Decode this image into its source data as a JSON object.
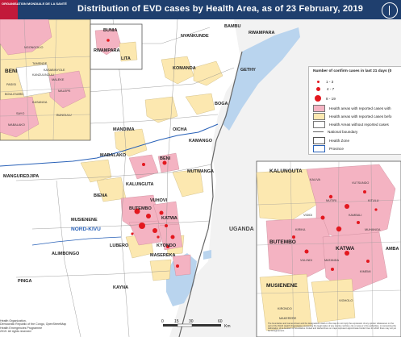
{
  "header": {
    "title": "Distribution of EVD cases by Health Area, as of 23 February, 2019",
    "logo_text": "ORGANISATION MONDIALE DE LA SANTÉ",
    "logo_word": "nté"
  },
  "colors": {
    "cases_21_days": "#f4b3c2",
    "cases_before": "#fce8b0",
    "no_cases": "#ffffff",
    "province_border": "#2a62b8",
    "case_dot": "#e3181f",
    "lake": "#b9d4ee"
  },
  "legend": {
    "title": "Number of confirm cases in last 21 days (0",
    "items": [
      {
        "label": "1 - 3",
        "type": "dot-small"
      },
      {
        "label": "4 - 7",
        "type": "dot-medium"
      },
      {
        "label": "8 - 19",
        "type": "dot-large"
      },
      {
        "label": "Health areas with reported cases with",
        "type": "fill-pink"
      },
      {
        "label": "Health areas with reported cases befo",
        "type": "fill-yellow"
      },
      {
        "label": "Health Areas without reported cases",
        "type": "fill-white"
      },
      {
        "label": "National boundary",
        "type": "line-gray"
      },
      {
        "label": "Health Zone",
        "type": "line-thin"
      },
      {
        "label": "Province",
        "type": "line-blue"
      }
    ]
  },
  "map_labels": {
    "zones": [
      "BUNIA",
      "RWAMPARA",
      "LITA",
      "NYANKUNDE",
      "BAMBU",
      "RWAMPARA",
      "GETHY",
      "KOMANDA",
      "BOGA",
      "MANDIMA",
      "OICHA",
      "KAMANGO",
      "MABALAKO",
      "BENI",
      "MUTWANGA",
      "MANGUREDJIPA",
      "KALUNGUTA",
      "BIENA",
      "VUHOVI",
      "MUSIENENE",
      "BUTEMBO",
      "KATWA",
      "LUBERO",
      "ALIMBONGO",
      "KYONDO",
      "MASEREKA",
      "PINGA",
      "KAYNA",
      "KALUNGUTA",
      "BUTEMBO",
      "KATWA",
      "MUSIENENE",
      "BENI",
      "AMBA"
    ],
    "province": "NORD-KIVU",
    "country": "UGANDA",
    "inset_left_small": [
      "NGONGOLIO",
      "TAMENDE",
      "KANZULINZULI",
      "MALEKE",
      "PASISI",
      "KASABINYOLE",
      "BOULEVARD",
      "KASANGA",
      "SAYO",
      "BUNGULU",
      "MABALAKO",
      "MALEPE"
    ],
    "inset_right_small": [
      "KALIVA",
      "VUTSUNDO",
      "MUTIRI",
      "KITULU",
      "VIDIDI",
      "KAMBALI",
      "KIRIKA",
      "MUHANGA",
      "VIGHOLO",
      "MATANDA",
      "KIMEMI",
      "VULINDI",
      "KIRONDO",
      "MAKERERE"
    ]
  },
  "scale": {
    "ticks": [
      "0",
      "15",
      "30",
      "60"
    ],
    "unit": "Km"
  },
  "footer": {
    "lines": [
      "Health Organization,",
      "Democratic Republic of the Congo, OpenStreetMap",
      "Health Emergencies Programme",
      "2019. All rights reserved"
    ]
  },
  "disclaimer": "The boundaries and names shown and the designations used on this map do not imply the expression of any opinion whatsoever on the part of the World Health Organization concerning the legal status of any country, territory, city or area or of its authorities, or concerning the delimitation of its frontiers or boundaries. Dotted and dashed lines on maps represent approximate border lines for which there may not yet be full agreement."
}
